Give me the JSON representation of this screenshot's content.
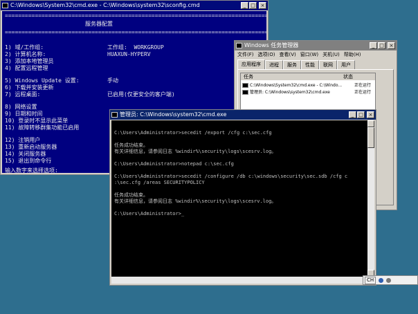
{
  "sconfig_window": {
    "title": "C:\\Windows\\System32\\cmd.exe - C:\\Windows\\system32\\sconfig.cmd",
    "separator": "================================================================================",
    "header": "服务器配置",
    "lines": [
      {
        "label": "1) 域/工作组:",
        "value": "工作组:  WORKGROUP"
      },
      {
        "label": "2) 计算机名称:",
        "value": "HUAXUN-HYPERV"
      },
      {
        "label": "3) 添加本地管理员",
        "value": ""
      },
      {
        "label": "4) 配置远程管理",
        "value": ""
      },
      {
        "label": "5) Windows Update 设置:",
        "value": "手动"
      },
      {
        "label": "6) 下载并安装更新",
        "value": ""
      },
      {
        "label": "7) 远程桌面:",
        "value": "已启用(仅更安全的客户端)"
      },
      {
        "label": "8) 网络设置",
        "value": ""
      },
      {
        "label": "9) 日期和时间",
        "value": ""
      },
      {
        "label": "10) 登录时不显示此菜单",
        "value": ""
      },
      {
        "label": "11) 故障转移群集功能已启用",
        "value": ""
      },
      {
        "label": "12) 注销用户",
        "value": ""
      },
      {
        "label": "13) 重新启动服务器",
        "value": ""
      },
      {
        "label": "14) 关闭服务器",
        "value": ""
      },
      {
        "label": "15) 退出到命令行",
        "value": ""
      }
    ],
    "prompt": "输入数字来选择选项:"
  },
  "taskmgr_window": {
    "title": "Windows 任务管理器",
    "menu": [
      "文件(F)",
      "选项(O)",
      "查看(V)",
      "窗口(W)",
      "关机(U)",
      "帮助(H)"
    ],
    "tabs": [
      "应用程序",
      "进程",
      "服务",
      "性能",
      "联网",
      "用户"
    ],
    "columns": {
      "task": "任务",
      "status": "状态"
    },
    "rows": [
      {
        "task": "C:\\Windows\\System32\\cmd.exe - C:\\Windo...",
        "status": "正在运行"
      },
      {
        "task": "管理员: C:\\Windows\\system32\\cmd.exe",
        "status": "正在运行"
      }
    ]
  },
  "cmd_window": {
    "title": "管理员: C:\\Windows\\system32\\cmd.exe",
    "lines": [
      "C:\\Users\\Administrator>secedit /export /cfg c:\\sec.cfg",
      "",
      "任务成功结束。",
      "有关详细信息，请参阅日志 %windir%\\security\\logs\\scesrv.log。",
      "",
      "C:\\Users\\Administrator>notepad c:\\sec.cfg",
      "",
      "C:\\Users\\Administrator>secedit /configure /db c:\\windows\\security\\sec.sdb /cfg c",
      ":\\sec.cfg /areas SECURITYPOLICY",
      "",
      "任务成功结束。",
      "有关详细信息，请参阅日志 %windir%\\security\\logs\\scesrv.log。",
      "",
      "C:\\Users\\Administrator>_"
    ]
  },
  "ime_bar": {
    "label": "CH"
  }
}
